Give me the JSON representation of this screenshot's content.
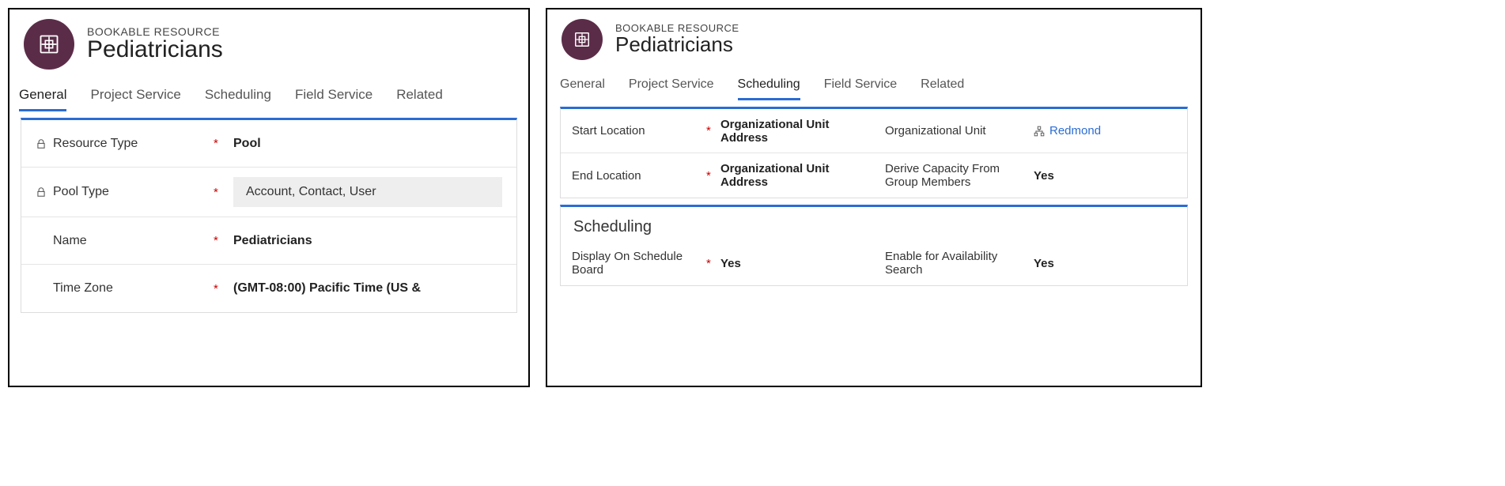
{
  "left": {
    "header": {
      "label": "BOOKABLE RESOURCE",
      "title": "Pediatricians"
    },
    "tabs": [
      "General",
      "Project Service",
      "Scheduling",
      "Field Service",
      "Related"
    ],
    "activeTab": "General",
    "fields": {
      "resourceType": {
        "label": "Resource Type",
        "value": "Pool",
        "required": "*",
        "locked": true
      },
      "poolType": {
        "label": "Pool Type",
        "value": "Account, Contact, User",
        "required": "*",
        "locked": true
      },
      "name": {
        "label": "Name",
        "value": "Pediatricians",
        "required": "*"
      },
      "timeZone": {
        "label": "Time Zone",
        "value": "(GMT-08:00) Pacific Time (US &",
        "required": "*"
      }
    }
  },
  "right": {
    "header": {
      "label": "BOOKABLE RESOURCE",
      "title": "Pediatricians"
    },
    "tabs": [
      "General",
      "Project Service",
      "Scheduling",
      "Field Service",
      "Related"
    ],
    "activeTab": "Scheduling",
    "section1": {
      "startLocation": {
        "label": "Start Location",
        "value": "Organizational Unit Address",
        "required": "*"
      },
      "endLocation": {
        "label": "End Location",
        "value": "Organizational Unit Address",
        "required": "*"
      },
      "orgUnit": {
        "label": "Organizational Unit",
        "value": "Redmond"
      },
      "deriveCapacity": {
        "label": "Derive Capacity From Group Members",
        "value": "Yes"
      }
    },
    "section2": {
      "title": "Scheduling",
      "displayOnBoard": {
        "label": "Display On Schedule Board",
        "value": "Yes",
        "required": "*"
      },
      "enableAvailSearch": {
        "label": "Enable for Availability Search",
        "value": "Yes"
      }
    }
  }
}
